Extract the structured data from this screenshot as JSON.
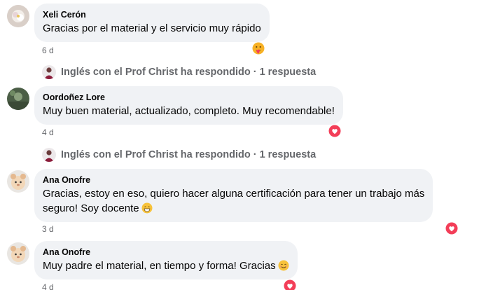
{
  "comments": [
    {
      "author": "Xeli Cerón",
      "text": "Gracias por el material y el servicio muy rápido",
      "time": "6 d",
      "reaction": "care-reaction-icon"
    },
    {
      "author": "Oordoñez Lore",
      "text": "Muy buen material, actualizado, completo. Muy recomendable!",
      "time": "4 d",
      "reaction": "love-reaction-icon"
    },
    {
      "author": "Ana Onofre",
      "text_line1": "Gracias, estoy en eso, quiero hacer alguna certificación para tener un trabajo más",
      "text_line2": "seguro! Soy docente",
      "time": "3 d",
      "reaction": "love-reaction-icon",
      "emoji": "grinning-face-emoji"
    },
    {
      "author": "Ana Onofre",
      "text": "Muy padre el material, en tiempo y forma! Gracias",
      "time": "4 d",
      "reaction": "love-reaction-icon",
      "emoji": "smiling-face-emoji"
    }
  ],
  "replies": [
    {
      "text": "Inglés con el Prof Christ ha respondido · 1 respuesta"
    },
    {
      "text": "Inglés con el Prof Christ ha respondido · 1 respuesta"
    }
  ],
  "colors": {
    "bubble": "#f0f2f5",
    "secondary_text": "#65676b",
    "love": "#f33e58",
    "care": "#f7b125"
  }
}
